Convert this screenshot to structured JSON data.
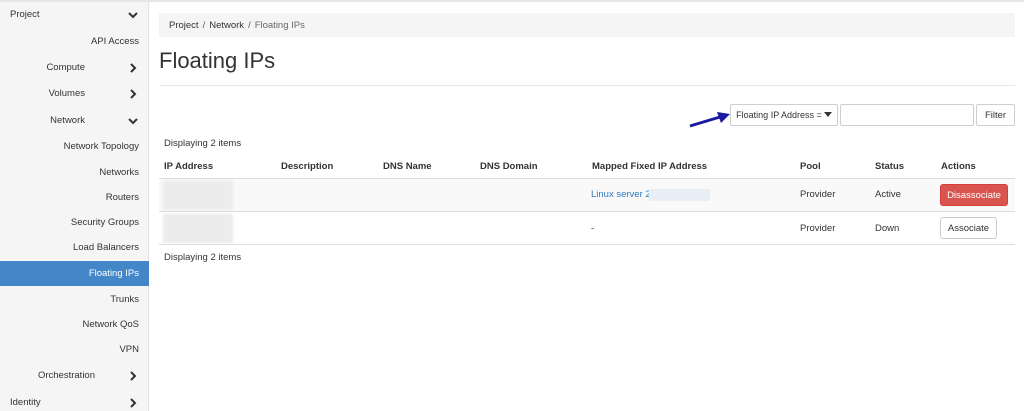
{
  "sidebar": {
    "project": "Project",
    "items": [
      {
        "label": "API Access",
        "kind": "leaf"
      },
      {
        "label": "Compute",
        "kind": "group",
        "chevron": "right"
      },
      {
        "label": "Volumes",
        "kind": "group",
        "chevron": "right"
      },
      {
        "label": "Network",
        "kind": "group",
        "chevron": "down"
      },
      {
        "label": "Network Topology",
        "kind": "leaf"
      },
      {
        "label": "Networks",
        "kind": "leaf"
      },
      {
        "label": "Routers",
        "kind": "leaf"
      },
      {
        "label": "Security Groups",
        "kind": "leaf"
      },
      {
        "label": "Load Balancers",
        "kind": "leaf"
      },
      {
        "label": "Floating IPs",
        "kind": "leaf",
        "active": true
      },
      {
        "label": "Trunks",
        "kind": "leaf"
      },
      {
        "label": "Network QoS",
        "kind": "leaf"
      },
      {
        "label": "VPN",
        "kind": "leaf"
      },
      {
        "label": "Orchestration",
        "kind": "group",
        "chevron": "right"
      }
    ],
    "identity": "Identity"
  },
  "breadcrumb": {
    "items": [
      "Project",
      "Network",
      "Floating IPs"
    ],
    "separator": "/"
  },
  "page_title": "Floating IPs",
  "filter": {
    "field_label": "Floating IP Address =",
    "input_value": "",
    "button_label": "Filter"
  },
  "table": {
    "displaying_top": "Displaying 2 items",
    "displaying_bottom": "Displaying 2 items",
    "columns": [
      "IP Address",
      "Description",
      "DNS Name",
      "DNS Domain",
      "Mapped Fixed IP Address",
      "Pool",
      "Status",
      "Actions"
    ],
    "rows": [
      {
        "ip": "",
        "description": "",
        "dns_name": "",
        "dns_domain": "",
        "mapped": "Linux server 2",
        "pool": "Provider",
        "status": "Active",
        "action": "Disassociate"
      },
      {
        "ip": "",
        "description": "",
        "dns_name": "",
        "dns_domain": "",
        "mapped": "-",
        "pool": "Provider",
        "status": "Down",
        "action": "Associate"
      }
    ]
  },
  "colors": {
    "active_nav": "#4487c8",
    "danger": "#d9534f",
    "link": "#2c7bbf",
    "arrow": "#1a1aa0"
  },
  "icons": {
    "chevron_right": "chevron-right-icon",
    "chevron_down": "chevron-down-icon",
    "caret": "caret-down-icon",
    "annotation": "arrow-icon"
  }
}
